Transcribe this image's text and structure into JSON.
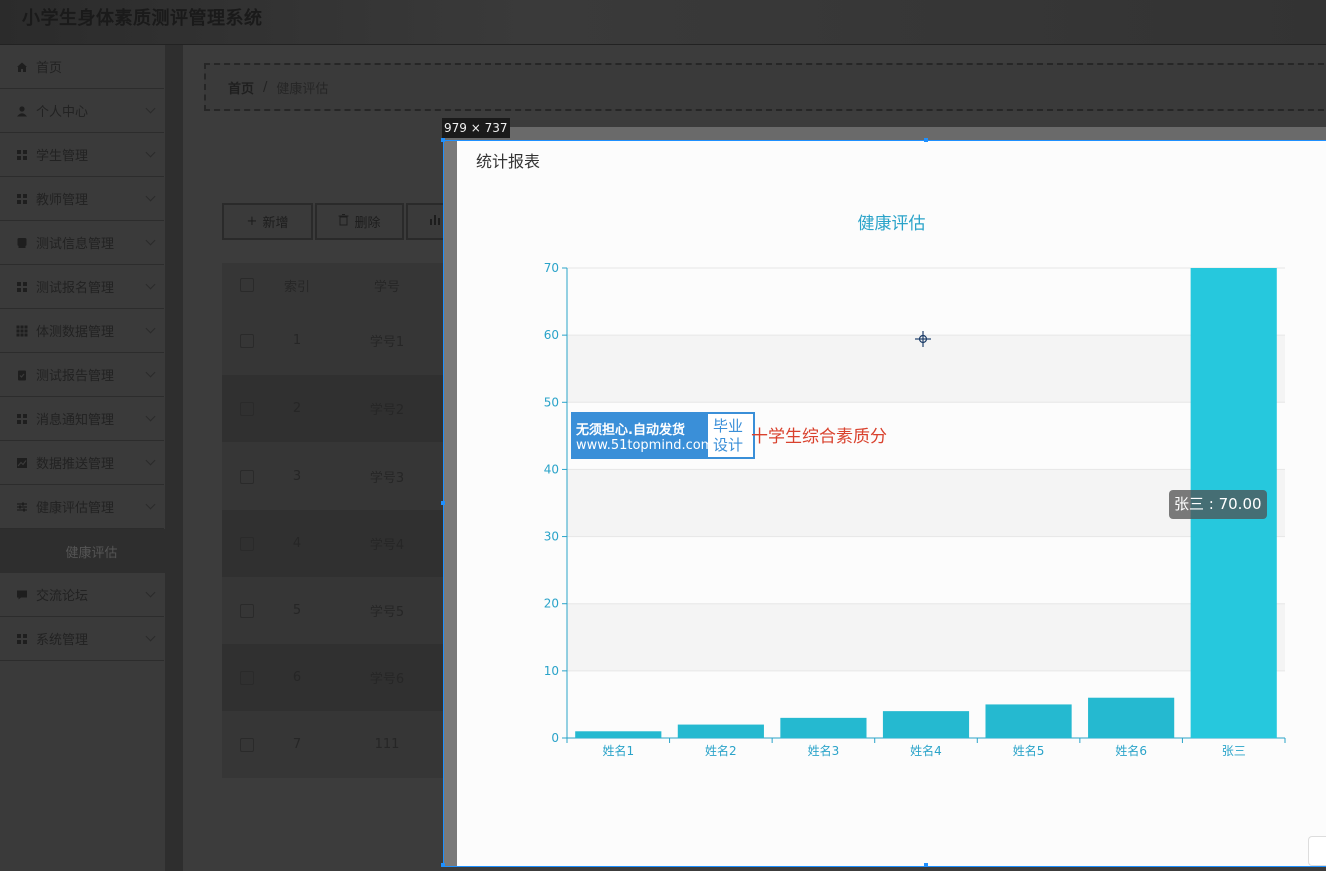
{
  "app": {
    "title": "小学生身体素质测评管理系统"
  },
  "sidebar": {
    "items": [
      {
        "label": "首页",
        "icon": "home-icon"
      },
      {
        "label": "个人中心",
        "icon": "user-icon"
      },
      {
        "label": "学生管理",
        "icon": "grid-icon"
      },
      {
        "label": "教师管理",
        "icon": "grid-icon"
      },
      {
        "label": "测试信息管理",
        "icon": "tag-icon"
      },
      {
        "label": "测试报名管理",
        "icon": "grid-icon"
      },
      {
        "label": "体测数据管理",
        "icon": "apps-icon"
      },
      {
        "label": "测试报告管理",
        "icon": "clipboard-icon"
      },
      {
        "label": "消息通知管理",
        "icon": "grid-icon"
      },
      {
        "label": "数据推送管理",
        "icon": "chart-icon"
      },
      {
        "label": "健康评估管理",
        "icon": "sliders-icon"
      },
      {
        "label": "交流论坛",
        "icon": "chat-icon"
      },
      {
        "label": "系统管理",
        "icon": "grid-icon"
      }
    ],
    "active_sub": "健康评估"
  },
  "breadcrumb": {
    "home": "首页",
    "separator": "/",
    "current": "健康评估"
  },
  "toolbar": {
    "add_label": "新增",
    "delete_label": "删除",
    "stat_label": "统"
  },
  "table": {
    "headers": {
      "index": "索引",
      "student_no": "学号"
    },
    "rows": [
      {
        "index": "1",
        "student_no": "学号1"
      },
      {
        "index": "2",
        "student_no": "学号2"
      },
      {
        "index": "3",
        "student_no": "学号3"
      },
      {
        "index": "4",
        "student_no": "学号4"
      },
      {
        "index": "5",
        "student_no": "学号5"
      },
      {
        "index": "6",
        "student_no": "学号6"
      },
      {
        "index": "7",
        "student_no": "111"
      }
    ]
  },
  "capture": {
    "size_label": "979 × 737"
  },
  "dialog": {
    "title": "统计报表"
  },
  "chart_data": {
    "type": "bar",
    "title": "健康评估",
    "categories": [
      "姓名1",
      "姓名2",
      "姓名3",
      "姓名4",
      "姓名5",
      "姓名6",
      "张三"
    ],
    "values": [
      1,
      2,
      3,
      4,
      5,
      6,
      70
    ],
    "ylim": [
      0,
      70
    ],
    "yticks": [
      0,
      10,
      20,
      30,
      40,
      50,
      60,
      70
    ],
    "grid": true,
    "bar_color": "#25b9d0",
    "highlight_color": "#26c8dd",
    "axis_color": "#2aa3c9"
  },
  "tooltip": {
    "text": "张三 : 70.00"
  },
  "watermark": {
    "line1": "无须担心.自动发货",
    "line2": "www.51topmind.com",
    "side1": "毕业",
    "side2": "设计",
    "caption": "十学生综合素质分"
  }
}
